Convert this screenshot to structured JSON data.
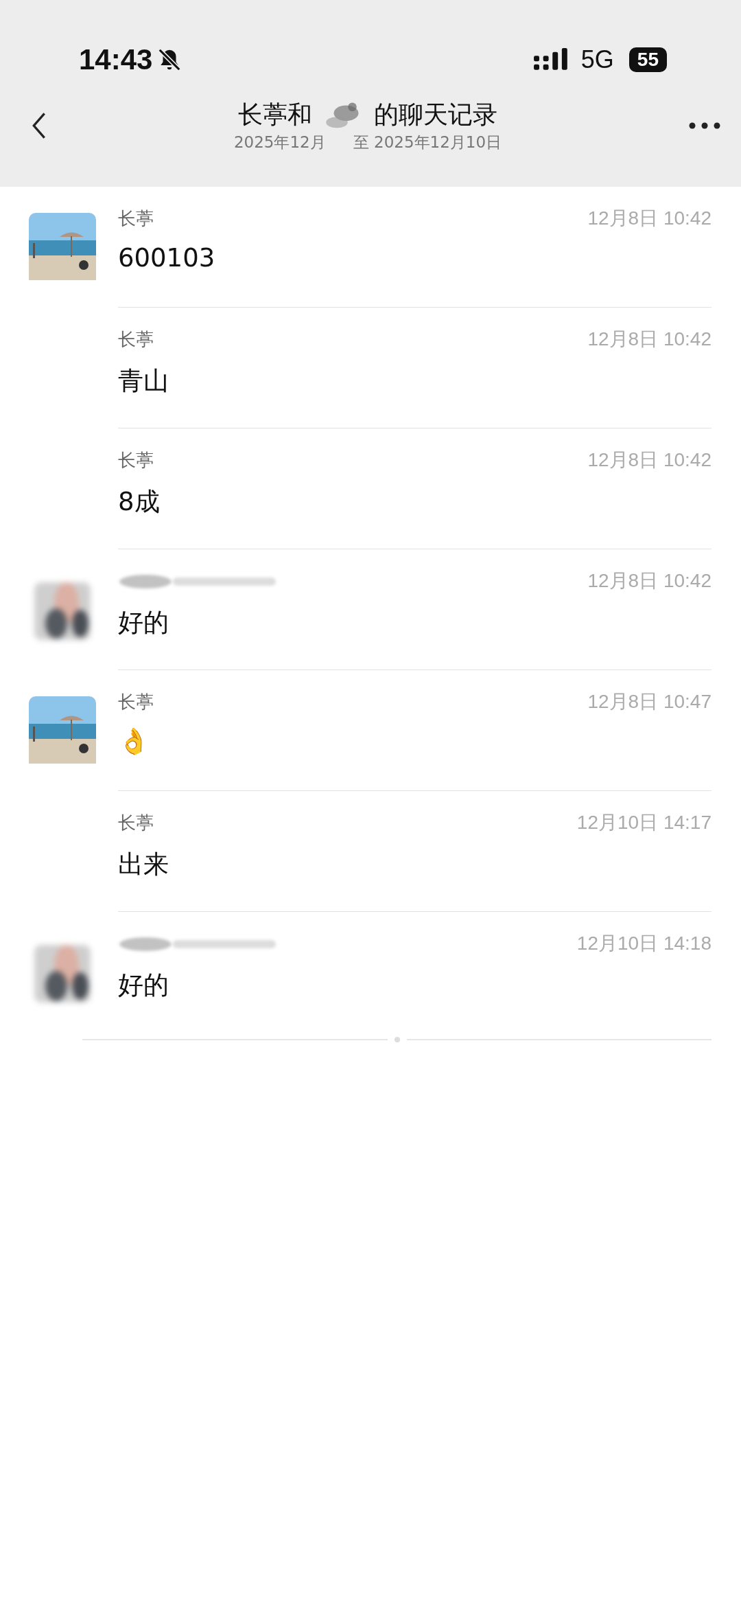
{
  "status_bar": {
    "time": "14:43",
    "network": "5G",
    "battery": "55"
  },
  "header": {
    "title_start": "长葶和",
    "title_end": "的聊天记录",
    "subtitle_start": "2025年12月",
    "subtitle_end": "至 2025年12月10日",
    "name_hidden": true
  },
  "messages": [
    {
      "kind": "mine",
      "sender": "长葶",
      "time": "12月8日 10:42",
      "text": "600103"
    },
    {
      "kind": "continued",
      "sender": "长葶",
      "time": "12月8日 10:42",
      "text": "青山"
    },
    {
      "kind": "continued",
      "sender": "长葶",
      "time": "12月8日 10:42",
      "text": "8成"
    },
    {
      "kind": "other",
      "sender_hidden": true,
      "time": "12月8日 10:42",
      "text": "好的"
    },
    {
      "kind": "mine",
      "sender": "长葶",
      "time": "12月8日 10:47",
      "text": "👌"
    },
    {
      "kind": "continued",
      "sender": "长葶",
      "time": "12月10日 14:17",
      "text": "出来"
    },
    {
      "kind": "other",
      "sender_hidden": true,
      "time": "12月10日 14:18",
      "text": "好的"
    }
  ]
}
